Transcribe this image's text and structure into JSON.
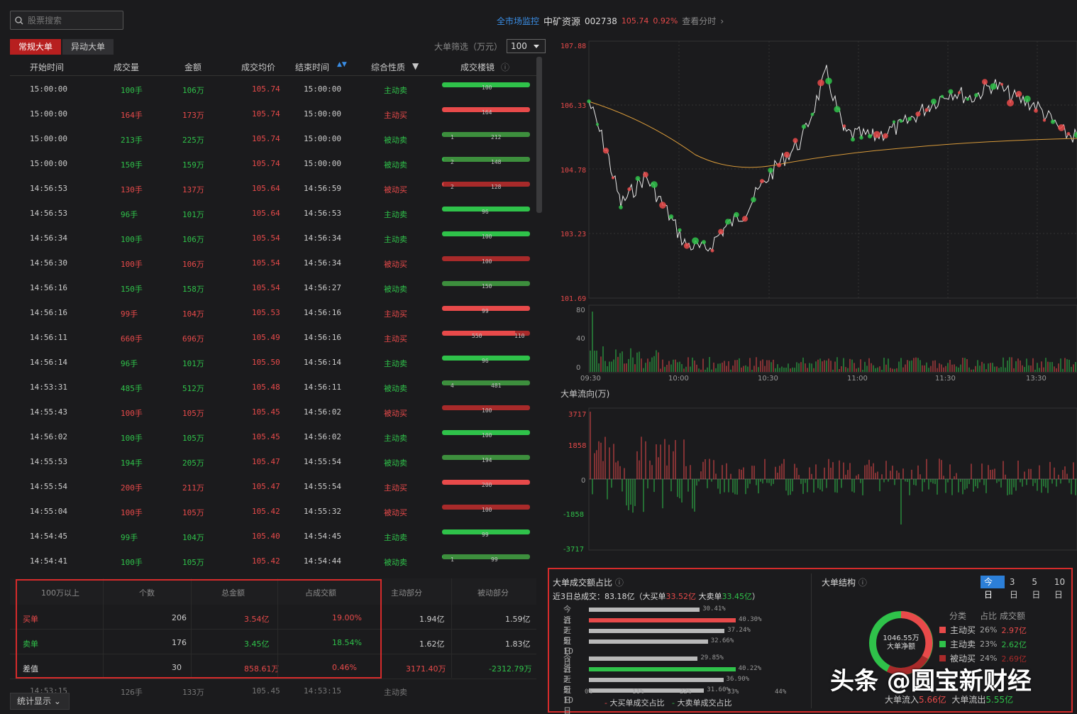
{
  "search": {
    "placeholder": "股票搜索"
  },
  "tabs": [
    {
      "label": "常规大单",
      "active": true
    },
    {
      "label": "异动大单",
      "active": false
    }
  ],
  "filter": {
    "label": "大单筛选（万元）",
    "value": "100"
  },
  "header": {
    "monitor": "全市场监控",
    "name": "中矿资源",
    "code": "002738",
    "price": "105.74",
    "change": "0.92%",
    "link": "查看分时"
  },
  "columns": [
    "开始时间",
    "成交量",
    "金额",
    "成交均价",
    "结束时间",
    "综合性质",
    "成交楼镜"
  ],
  "rows": [
    {
      "start": "15:00:00",
      "vol": "100手",
      "amt": "106万",
      "avg": "105.74",
      "end": "15:00:00",
      "type": "主动卖",
      "c": "green",
      "bars": [
        [
          "g",
          100
        ]
      ],
      "labels": [
        "100"
      ]
    },
    {
      "start": "15:00:00",
      "vol": "164手",
      "amt": "173万",
      "avg": "105.74",
      "end": "15:00:00",
      "type": "主动买",
      "c": "red",
      "bars": [
        [
          "r",
          100
        ]
      ],
      "labels": [
        "164"
      ]
    },
    {
      "start": "15:00:00",
      "vol": "213手",
      "amt": "225万",
      "avg": "105.74",
      "end": "15:00:00",
      "type": "被动卖",
      "c": "green",
      "bars": [
        [
          "g",
          1
        ],
        [
          "dg",
          99
        ]
      ],
      "labels": [
        "1",
        "212"
      ]
    },
    {
      "start": "15:00:00",
      "vol": "150手",
      "amt": "159万",
      "avg": "105.74",
      "end": "15:00:00",
      "type": "被动卖",
      "c": "green",
      "bars": [
        [
          "g",
          2
        ],
        [
          "dg",
          98
        ]
      ],
      "labels": [
        "2",
        "148"
      ]
    },
    {
      "start": "14:56:53",
      "vol": "130手",
      "amt": "137万",
      "avg": "105.64",
      "end": "14:56:59",
      "type": "被动买",
      "c": "red",
      "bars": [
        [
          "r",
          2
        ],
        [
          "dr",
          98
        ]
      ],
      "labels": [
        "2",
        "128"
      ]
    },
    {
      "start": "14:56:53",
      "vol": "96手",
      "amt": "101万",
      "avg": "105.64",
      "end": "14:56:53",
      "type": "主动卖",
      "c": "green",
      "bars": [
        [
          "g",
          100
        ]
      ],
      "labels": [
        "96"
      ]
    },
    {
      "start": "14:56:34",
      "vol": "100手",
      "amt": "106万",
      "avg": "105.54",
      "end": "14:56:34",
      "type": "主动卖",
      "c": "green",
      "bars": [
        [
          "g",
          100
        ]
      ],
      "labels": [
        "100"
      ]
    },
    {
      "start": "14:56:30",
      "vol": "100手",
      "amt": "106万",
      "avg": "105.54",
      "end": "14:56:34",
      "type": "被动买",
      "c": "red",
      "bars": [
        [
          "dr",
          100
        ]
      ],
      "labels": [
        "100"
      ]
    },
    {
      "start": "14:56:16",
      "vol": "150手",
      "amt": "158万",
      "avg": "105.54",
      "end": "14:56:27",
      "type": "被动卖",
      "c": "green",
      "bars": [
        [
          "dg",
          100
        ]
      ],
      "labels": [
        "150"
      ]
    },
    {
      "start": "14:56:16",
      "vol": "99手",
      "amt": "104万",
      "avg": "105.53",
      "end": "14:56:16",
      "type": "主动买",
      "c": "red",
      "bars": [
        [
          "r",
          100
        ]
      ],
      "labels": [
        "99"
      ]
    },
    {
      "start": "14:56:11",
      "vol": "660手",
      "amt": "696万",
      "avg": "105.49",
      "end": "14:56:16",
      "type": "主动买",
      "c": "red",
      "bars": [
        [
          "r",
          83
        ],
        [
          "dr",
          17
        ]
      ],
      "labels": [
        "550",
        "110"
      ]
    },
    {
      "start": "14:56:14",
      "vol": "96手",
      "amt": "101万",
      "avg": "105.50",
      "end": "14:56:14",
      "type": "主动卖",
      "c": "green",
      "bars": [
        [
          "g",
          100
        ]
      ],
      "labels": [
        "96"
      ]
    },
    {
      "start": "14:53:31",
      "vol": "485手",
      "amt": "512万",
      "avg": "105.48",
      "end": "14:56:11",
      "type": "被动卖",
      "c": "green",
      "bars": [
        [
          "g",
          1
        ],
        [
          "dg",
          99
        ]
      ],
      "labels": [
        "4",
        "481"
      ]
    },
    {
      "start": "14:55:43",
      "vol": "100手",
      "amt": "105万",
      "avg": "105.45",
      "end": "14:56:02",
      "type": "被动买",
      "c": "red",
      "bars": [
        [
          "dr",
          100
        ]
      ],
      "labels": [
        "100"
      ]
    },
    {
      "start": "14:56:02",
      "vol": "100手",
      "amt": "105万",
      "avg": "105.45",
      "end": "14:56:02",
      "type": "主动卖",
      "c": "green",
      "bars": [
        [
          "g",
          100
        ]
      ],
      "labels": [
        "100"
      ]
    },
    {
      "start": "14:55:53",
      "vol": "194手",
      "amt": "205万",
      "avg": "105.47",
      "end": "14:55:54",
      "type": "被动卖",
      "c": "green",
      "bars": [
        [
          "dg",
          100
        ]
      ],
      "labels": [
        "194"
      ]
    },
    {
      "start": "14:55:54",
      "vol": "200手",
      "amt": "211万",
      "avg": "105.47",
      "end": "14:55:54",
      "type": "主动买",
      "c": "red",
      "bars": [
        [
          "r",
          100
        ]
      ],
      "labels": [
        "200"
      ]
    },
    {
      "start": "14:55:04",
      "vol": "100手",
      "amt": "105万",
      "avg": "105.42",
      "end": "14:55:32",
      "type": "被动买",
      "c": "red",
      "bars": [
        [
          "dr",
          100
        ]
      ],
      "labels": [
        "100"
      ]
    },
    {
      "start": "14:54:45",
      "vol": "99手",
      "amt": "104万",
      "avg": "105.40",
      "end": "14:54:45",
      "type": "主动卖",
      "c": "green",
      "bars": [
        [
          "g",
          100
        ]
      ],
      "labels": [
        "99"
      ]
    },
    {
      "start": "14:54:41",
      "vol": "100手",
      "amt": "105万",
      "avg": "105.42",
      "end": "14:54:44",
      "type": "被动卖",
      "c": "green",
      "bars": [
        [
          "g",
          1
        ],
        [
          "dg",
          99
        ]
      ],
      "labels": [
        "1",
        "99"
      ]
    }
  ],
  "summary": {
    "headers": [
      "100万以上",
      "个数",
      "总金额",
      "占成交额",
      "主动部分",
      "被动部分"
    ],
    "rows": [
      {
        "label": "买单",
        "c": "red",
        "count": "206",
        "total": "3.54亿",
        "pct": "19.00%",
        "active": "1.94亿",
        "passive": "1.59亿"
      },
      {
        "label": "卖单",
        "c": "green",
        "count": "176",
        "total": "3.45亿",
        "pct": "18.54%",
        "active": "1.62亿",
        "passive": "1.83亿"
      },
      {
        "label": "差值",
        "c": "white",
        "count": "30",
        "total": "858.61万",
        "pct": "0.46%",
        "active": "3171.40万",
        "passive": "-2312.79万"
      }
    ],
    "partial_row": {
      "start": "14:53:15",
      "vol": "126手",
      "amt": "133万",
      "avg": "105.45",
      "end": "14:53:15",
      "type": "主动卖"
    }
  },
  "stat_button": "统计显示",
  "price_axis": [
    "107.88",
    "106.33",
    "104.78",
    "103.23",
    "101.69"
  ],
  "volume_axis": [
    "80",
    "40",
    "0"
  ],
  "time_axis": [
    "09:30",
    "10:00",
    "10:30",
    "11:00",
    "11:30",
    "13:30"
  ],
  "flow_title": "大单流向(万)",
  "flow_axis": [
    "3717",
    "1858",
    "0",
    "-1858",
    "-3717"
  ],
  "ratio": {
    "title": "大单成交额占比",
    "subtitle_prefix": "近3日总成交：83.18亿（大买单",
    "buy_amt": "33.52亿",
    "mid": " 大卖单",
    "sell_amt": "33.45亿",
    "suffix": "）",
    "buy_rows": [
      {
        "label": "今日",
        "pct": "30.41%",
        "v": 30.41
      },
      {
        "label": "近3日",
        "pct": "40.30%",
        "v": 40.3
      },
      {
        "label": "近5日",
        "pct": "37.24%",
        "v": 37.24
      },
      {
        "label": "近10日",
        "pct": "32.66%",
        "v": 32.66
      }
    ],
    "sell_rows": [
      {
        "label": "今日",
        "pct": "29.85%",
        "v": 29.85
      },
      {
        "label": "近3日",
        "pct": "40.22%",
        "v": 40.22
      },
      {
        "label": "近5日",
        "pct": "36.90%",
        "v": 36.9
      },
      {
        "label": "近10日",
        "pct": "31.60%",
        "v": 31.6
      }
    ],
    "axis": [
      "0%",
      "11%",
      "22%",
      "33%",
      "44%"
    ],
    "legend_buy": "大买单成交占比",
    "legend_sell": "大卖单成交占比"
  },
  "structure": {
    "title": "大单结构",
    "periods": [
      "今日",
      "3日",
      "5日",
      "10日"
    ],
    "center_value": "1046.55万",
    "center_label": "大单净额",
    "col1": "分类",
    "col2": "占比",
    "col3": "成交额",
    "items": [
      {
        "name": "主动买",
        "pct": "26%",
        "amt": "2.97亿",
        "color": "#e84a4a"
      },
      {
        "name": "主动卖",
        "pct": "23%",
        "amt": "2.62亿",
        "color": "#2fc24a"
      },
      {
        "name": "被动买",
        "pct": "24%",
        "amt": "2.69亿",
        "color": "#a82a2a"
      }
    ],
    "inflow_label": "大单流入",
    "inflow": "5.66亿",
    "outflow_label": "大单流出",
    "outflow": "5.55亿"
  },
  "watermark": "头条 @圆宝新财经",
  "colors": {
    "red": "#e84a4a",
    "green": "#2fc24a",
    "dark_red": "#a82a2a",
    "dark_green": "#3d8f3d",
    "blue": "#2c7fd8",
    "avg_line": "#d89a3a"
  }
}
